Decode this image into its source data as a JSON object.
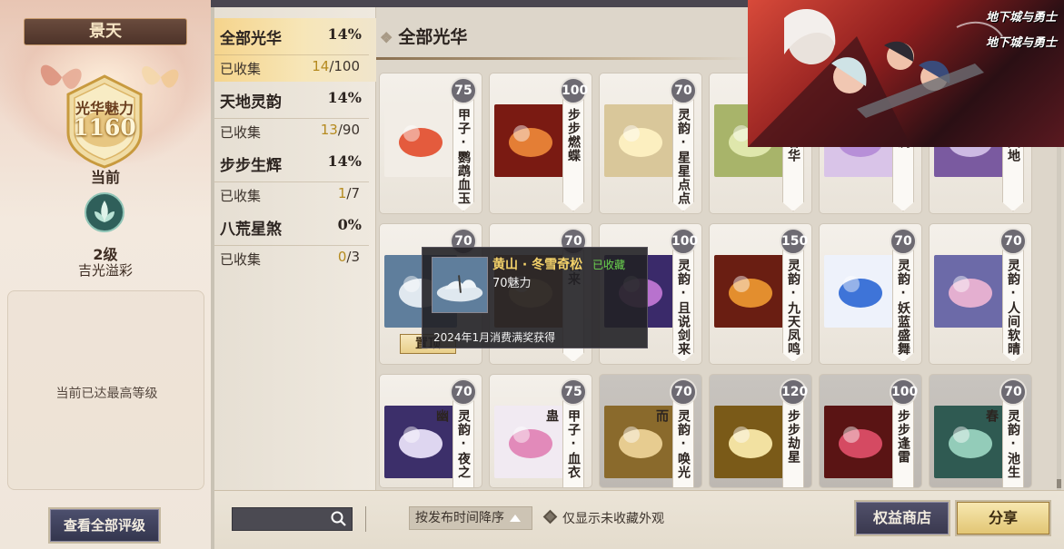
{
  "left": {
    "title": "景天",
    "charm_label": "光华魅力",
    "charm_value": "1160",
    "current_label": "当前",
    "level_num": "2级",
    "level_name": "吉光溢彩",
    "max_text": "当前已达最高等级",
    "view_all_btn": "查看全部评级"
  },
  "categories": [
    {
      "name": "全部光华",
      "pct": "14%",
      "collected_label": "已收集",
      "got": "14",
      "total": "/100",
      "active": true
    },
    {
      "name": "天地灵韵",
      "pct": "14%",
      "collected_label": "已收集",
      "got": "13",
      "total": "/90",
      "active": false
    },
    {
      "name": "步步生辉",
      "pct": "14%",
      "collected_label": "已收集",
      "got": "1",
      "total": "/7",
      "active": false
    },
    {
      "name": "八荒星煞",
      "pct": "0%",
      "collected_label": "已收集",
      "got": "0",
      "total": "/3",
      "active": false
    }
  ],
  "section_title": "全部光华",
  "cards": [
    {
      "pts": "75",
      "name": "甲子·鹦鹉血玉",
      "icon": "red-feather-icon"
    },
    {
      "pts": "100",
      "name": "步步燃蝶",
      "icon": "fire-butterfly-icon"
    },
    {
      "pts": "70",
      "name": "灵韵·星星点点",
      "icon": "stars-icon"
    },
    {
      "pts": "",
      "name": "石绽春华",
      "icon": "green-bloom-icon"
    },
    {
      "pts": "",
      "name": "郁金澜",
      "icon": "tulip-icon"
    },
    {
      "pts": "",
      "name": "格致天地",
      "icon": "purple-aura-icon"
    },
    {
      "pts": "70",
      "name": "",
      "icon": "snow-pine-icon",
      "pin_label": "置顶"
    },
    {
      "pts": "70",
      "name": "秋来",
      "icon": "autumn-icon"
    },
    {
      "pts": "100",
      "name": "灵韵·且说剑来",
      "icon": "sword-light-icon"
    },
    {
      "pts": "150",
      "name": "灵韵·九天凤鸣",
      "icon": "phoenix-icon"
    },
    {
      "pts": "70",
      "name": "灵韵·妖蓝盛舞",
      "icon": "blue-rose-icon"
    },
    {
      "pts": "70",
      "name": "灵韵·人间软晴",
      "icon": "rainbow-icon"
    },
    {
      "pts": "70",
      "name": "灵韵·夜之幽",
      "icon": "ghost-icon"
    },
    {
      "pts": "75",
      "name": "甲子·血衣蛊",
      "icon": "pink-butterfly-icon"
    },
    {
      "pts": "70",
      "name": "灵韵·唤光而",
      "icon": "golden-deer-icon"
    },
    {
      "pts": "120",
      "name": "步步劫星",
      "icon": "golden-orb-icon"
    },
    {
      "pts": "100",
      "name": "步步逢雷",
      "icon": "red-lightning-icon"
    },
    {
      "pts": "70",
      "name": "灵韵·池生春",
      "icon": "teal-swirl-icon"
    }
  ],
  "tooltip": {
    "title": "黄山 · 冬雪奇松",
    "owned": "已收藏",
    "charm": "70魅力",
    "source": "2024年1月消费满奖获得"
  },
  "bottom": {
    "sort_label": "按发布时间降序",
    "filter_label": "仅显示未收藏外观",
    "shop_btn": "权益商店",
    "share_btn": "分享"
  },
  "promo": {
    "logo_1": "地下城与勇士",
    "logo_2": "地下城与勇士"
  }
}
